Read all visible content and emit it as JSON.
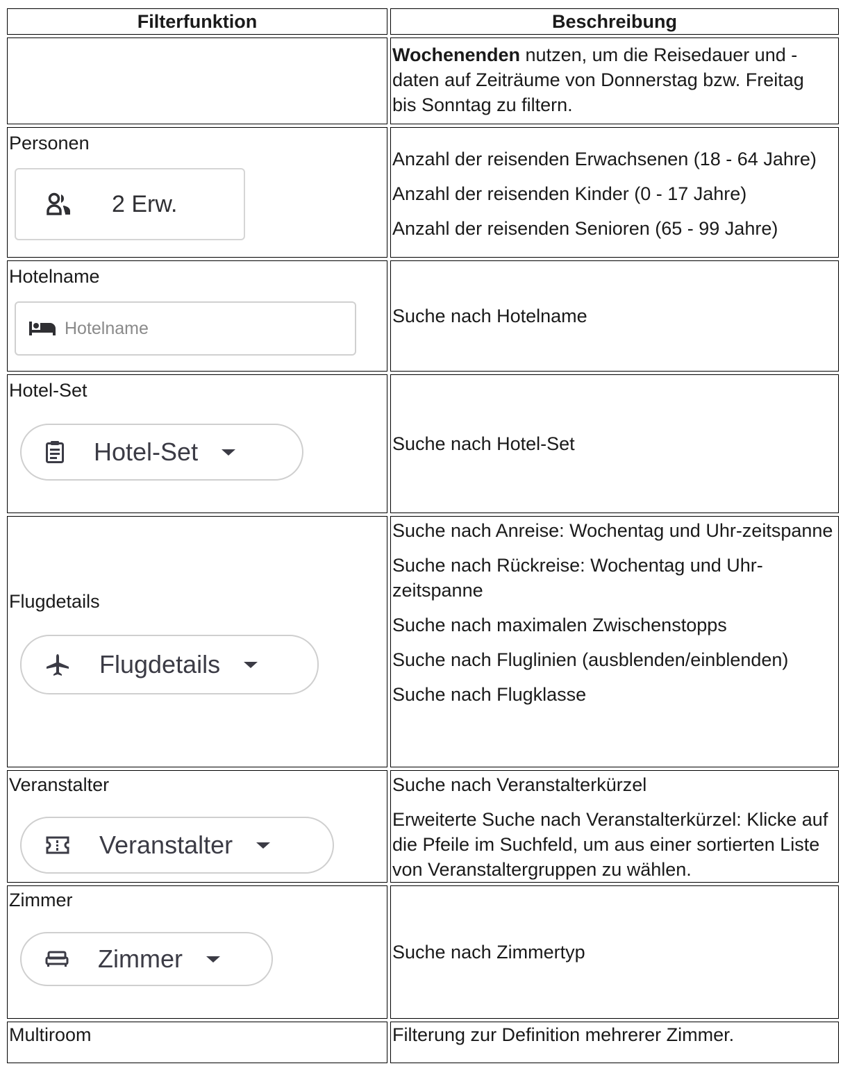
{
  "table": {
    "headers": [
      "Filterfunktion",
      "Beschreibung"
    ],
    "row_weekend": {
      "bold": "Wochenenden",
      "rest_line1": " nutzen, um die Reisedauer und -",
      "rest_line2": "daten auf Zeiträume von Donnerstag bzw. Freitag",
      "rest_line3": "bis Sonntag zu filtern."
    },
    "row_personen": {
      "label": "Personen",
      "widget_label": "2 Erw.",
      "widget_icon": "people-icon",
      "desc": [
        "Anzahl der reisenden Erwachsenen (18 - 64 Jahre)",
        "Anzahl der reisenden Kinder (0 - 17 Jahre)",
        "Anzahl der reisenden Senioren (65 - 99 Jahre)"
      ]
    },
    "row_hotelname": {
      "label": "Hotelname",
      "widget_placeholder": "Hotelname",
      "widget_icon": "bed-icon",
      "desc": "Suche nach Hotelname"
    },
    "row_hotelset": {
      "label": "Hotel-Set",
      "widget_label": "Hotel-Set",
      "widget_icon": "clipboard-icon",
      "desc": "Suche nach Hotel-Set"
    },
    "row_flug": {
      "label": "Flugdetails",
      "widget_label": "Flugdetails",
      "widget_icon": "airplane-icon",
      "desc": [
        "Suche nach Anreise: Wochentag und Uhr-zeitspanne",
        "Suche nach Rückreise: Wochentag und Uhr-zeitspanne",
        "Suche nach maximalen Zwischenstopps",
        "Suche nach Fluglinien (ausblenden/einblenden)",
        "Suche nach Flugklasse"
      ]
    },
    "row_veranstalter": {
      "label": "Veranstalter",
      "widget_label": "Veranstalter",
      "widget_icon": "ticket-icon",
      "desc": [
        "Suche nach Veranstalterkürzel",
        "Erweiterte Suche nach Veranstalterkürzel: Klicke auf die Pfeile im Suchfeld, um aus einer sortierten Liste von Veranstaltergruppen zu wählen."
      ]
    },
    "row_zimmer": {
      "label": "Zimmer",
      "widget_label": "Zimmer",
      "widget_icon": "sofa-bed-icon",
      "desc": "Suche nach Zimmertyp"
    },
    "row_multiroom": {
      "label": "Multiroom",
      "desc": "Filterung zur Definition mehrerer Zimmer."
    }
  }
}
